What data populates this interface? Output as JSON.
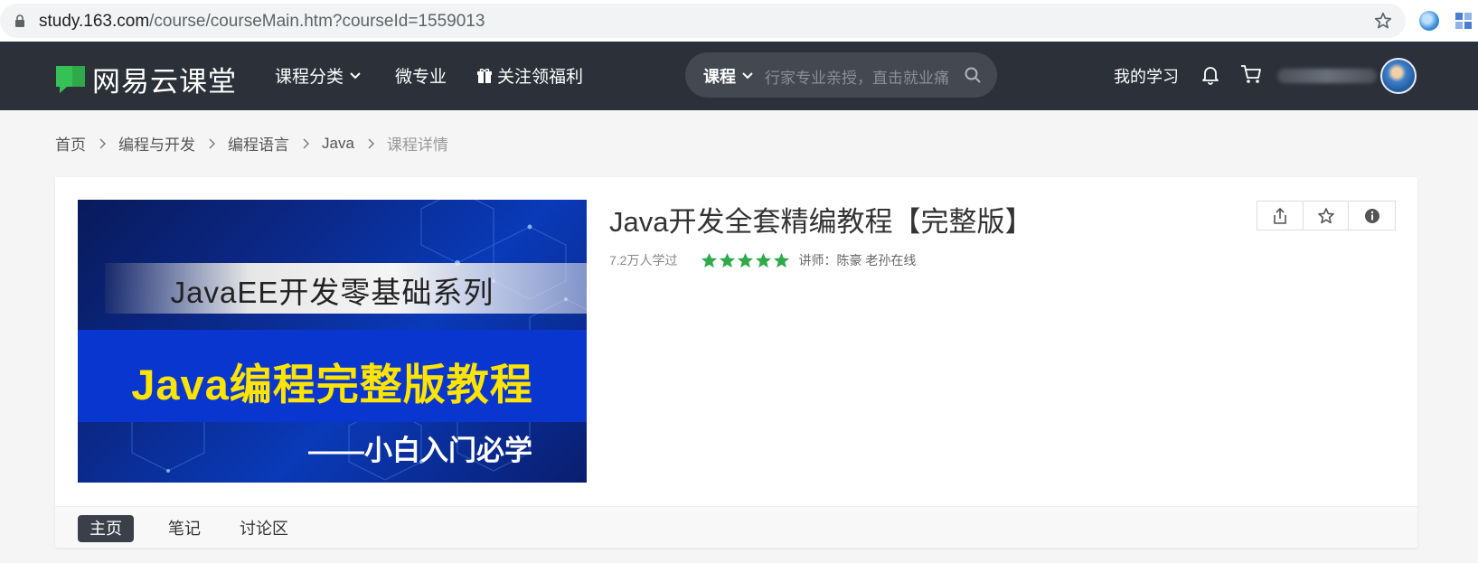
{
  "browser": {
    "url_host": "study.163.com",
    "url_path": "/course/courseMain.htm?courseId=1559013"
  },
  "header": {
    "logo_text": "网易云课堂",
    "nav": {
      "category": "课程分类",
      "micro_major": "微专业",
      "follow_benefit": "关注领福利"
    },
    "search": {
      "type_label": "课程",
      "placeholder": "行家专业亲授，直击就业痛"
    },
    "my_learning": "我的学习"
  },
  "breadcrumb": {
    "items": [
      "首页",
      "编程与开发",
      "编程语言",
      "Java"
    ],
    "current": "课程详情"
  },
  "course": {
    "cover": {
      "line1": "JavaEE开发零基础系列",
      "line2": "Java编程完整版教程",
      "line3": "——小白入门必学"
    },
    "title": "Java开发全套精编教程【完整版】",
    "learners": "7.2万人学过",
    "rating_stars": 5,
    "star_color": "#2eaa4a",
    "teacher_label": "讲师：",
    "teacher_name": "陈豪 老孙在线"
  },
  "tabs": {
    "home": "主页",
    "notes": "笔记",
    "discussion": "讨论区"
  },
  "colors": {
    "header_bg": "#2b3039",
    "logo_green": "#2eaa4a",
    "active_tab_bg": "#3a3f48"
  }
}
